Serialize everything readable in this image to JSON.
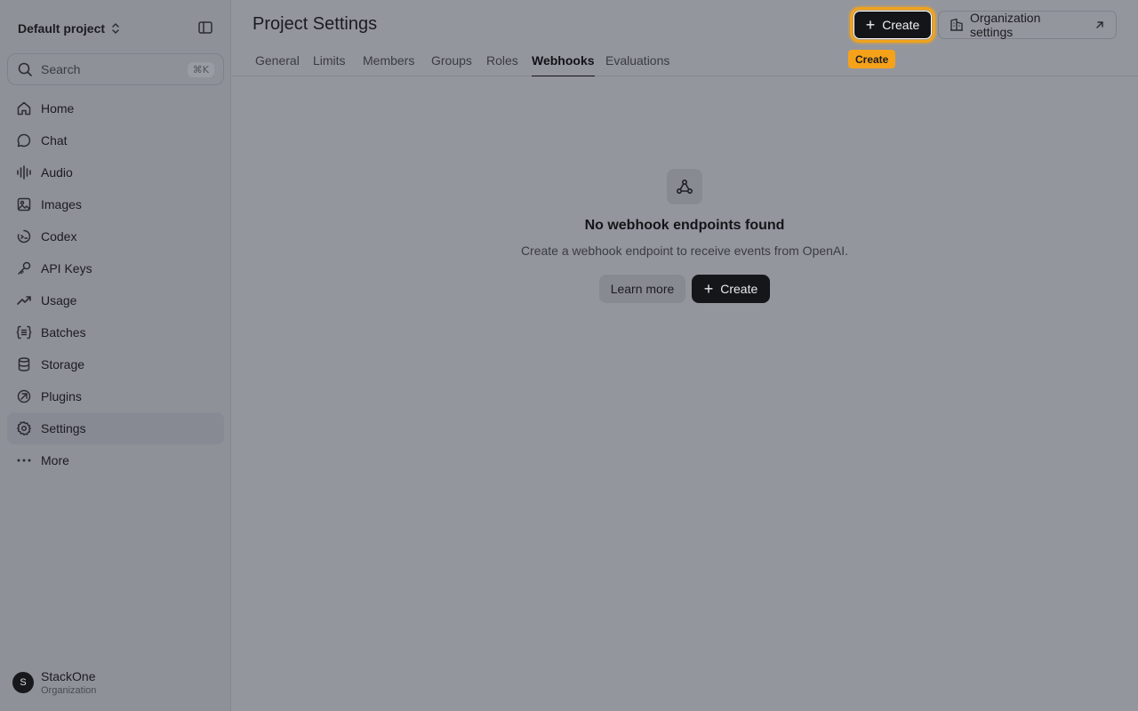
{
  "sidebar": {
    "project_name": "Default project",
    "search": {
      "label": "Search",
      "shortcut": "⌘K"
    },
    "items": [
      {
        "label": "Home",
        "icon": "home-icon"
      },
      {
        "label": "Chat",
        "icon": "chat-icon"
      },
      {
        "label": "Audio",
        "icon": "audio-icon"
      },
      {
        "label": "Images",
        "icon": "image-icon"
      },
      {
        "label": "Codex",
        "icon": "codex-icon"
      },
      {
        "label": "API Keys",
        "icon": "key-icon"
      },
      {
        "label": "Usage",
        "icon": "trend-icon"
      },
      {
        "label": "Batches",
        "icon": "batches-icon"
      },
      {
        "label": "Storage",
        "icon": "database-icon"
      },
      {
        "label": "Plugins",
        "icon": "plugin-icon"
      },
      {
        "label": "Settings",
        "icon": "gear-icon",
        "active": true
      },
      {
        "label": "More",
        "icon": "more-icon"
      }
    ],
    "org": {
      "initial": "S",
      "name": "StackOne",
      "subtitle": "Organization"
    }
  },
  "header": {
    "title": "Project Settings",
    "create_label": "Create",
    "create_tooltip": "Create",
    "org_settings_label": "Organization settings"
  },
  "tabs": [
    {
      "label": "General"
    },
    {
      "label": "Limits"
    },
    {
      "label": "Members"
    },
    {
      "label": "Groups"
    },
    {
      "label": "Roles"
    },
    {
      "label": "Webhooks",
      "active": true
    },
    {
      "label": "Evaluations"
    }
  ],
  "empty_state": {
    "icon": "webhook-icon",
    "title": "No webhook endpoints found",
    "description": "Create a webhook endpoint to receive events from OpenAI.",
    "learn_more_label": "Learn more",
    "create_label": "Create"
  },
  "colors": {
    "accent_highlight": "#f5a21a",
    "primary_button": "#141518"
  }
}
